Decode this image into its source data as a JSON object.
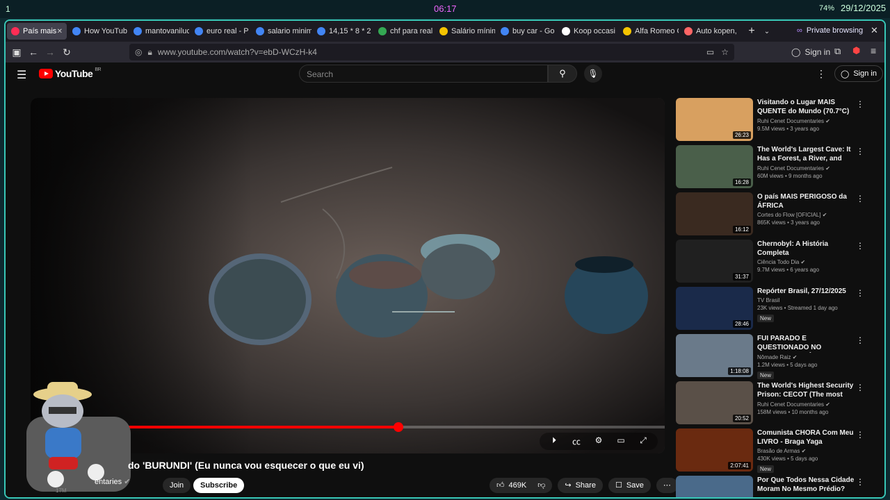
{
  "system": {
    "workspace": "1",
    "clock": "06:17",
    "battery": "74%",
    "date": "29/12/2025"
  },
  "tabs": [
    {
      "label": "País mais",
      "color": "#ff2d55",
      "active": true
    },
    {
      "label": "How YouTub",
      "color": "#4285f4"
    },
    {
      "label": "mantovaniluc",
      "color": "#4285f4"
    },
    {
      "label": "euro real - P",
      "color": "#4285f4"
    },
    {
      "label": "salario minim",
      "color": "#4285f4"
    },
    {
      "label": "14,15 * 8 * 2",
      "color": "#4285f4"
    },
    {
      "label": "chf para real",
      "color": "#34a853"
    },
    {
      "label": "Salário mínim",
      "color": "#f5c400"
    },
    {
      "label": "buy car - Go",
      "color": "#4285f4"
    },
    {
      "label": "Koop occasi",
      "color": "#ffffff"
    },
    {
      "label": "Alfa Romeo G",
      "color": "#f5c400"
    },
    {
      "label": "Auto kopen,",
      "color": "#ff6666"
    }
  ],
  "private_browsing": "Private browsing",
  "url": "www.youtube.com/watch?v=ebD-WCzH-k4",
  "browser_signin": "Sign in",
  "yt": {
    "logo_text": "YouTube",
    "region": "BR",
    "search_placeholder": "Search",
    "signin": "Sign in",
    "video_title": "do 'BURUNDI' (Eu nunca vou esquecer o que eu vi)",
    "channel": "entaries",
    "subs": "17M",
    "join": "Join",
    "subscribe": "Subscribe",
    "likes": "469K",
    "share": "Share",
    "save": "Save",
    "progress": 0.58
  },
  "recommendations": [
    {
      "title": "Visitando o Lugar MAIS QUENTE do Mundo (70.7°C) ...",
      "channel": "Ruhi Cenet Documentaries ✔",
      "meta": "9.5M views • 3 years ago",
      "duration": "26:23",
      "color": "#d8a060",
      "new": ""
    },
    {
      "title": "The World's Largest Cave: It Has a Forest, a River, and Clouds ...",
      "channel": "Ruhi Cenet Documentaries ✔",
      "meta": "60M views • 9 months ago",
      "duration": "16:28",
      "color": "#4a5f4a",
      "new": ""
    },
    {
      "title": "O país MAIS PERIGOSO da ÁFRICA",
      "channel": "Cortes do Flow [OFICIAL] ✔",
      "meta": "865K views • 3 years ago",
      "duration": "16:12",
      "color": "#3a2a20",
      "new": ""
    },
    {
      "title": "Chernobyl: A História Completa",
      "channel": "Ciência Todo Dia ✔",
      "meta": "9.7M views • 6 years ago",
      "duration": "31:37",
      "color": "#202020",
      "new": ""
    },
    {
      "title": "Repórter Brasil, 27/12/2025",
      "channel": "TV Brasil",
      "meta": "23K views • Streamed 1 day ago",
      "duration": "28:46",
      "color": "#1a2a4a",
      "new": "New"
    },
    {
      "title": "FUI PARADO E QUESTIONADO NO INTERIOR DO LÍBANO 🇱🇧",
      "channel": "Nômade Raiz ✔",
      "meta": "1.2M views • 5 days ago",
      "duration": "1:18:08",
      "color": "#6a7a8a",
      "new": "New"
    },
    {
      "title": "The World's Highest Security Prison: CECOT (The most evil ...",
      "channel": "Ruhi Cenet Documentaries ✔",
      "meta": "158M views • 10 months ago",
      "duration": "20:52",
      "color": "#5a5048",
      "new": ""
    },
    {
      "title": "Comunista CHORA Com Meu LIVRO - Braga Yaga",
      "channel": "Brasão de Armas ✔",
      "meta": "430K views • 5 days ago",
      "duration": "2:07:41",
      "color": "#6a2a10",
      "new": "New"
    },
    {
      "title": "Por Que Todos Nessa Cidade Moram No Mesmo Prédio?",
      "channel": "",
      "meta": "",
      "duration": "",
      "color": "#4a6a8a",
      "new": ""
    }
  ]
}
